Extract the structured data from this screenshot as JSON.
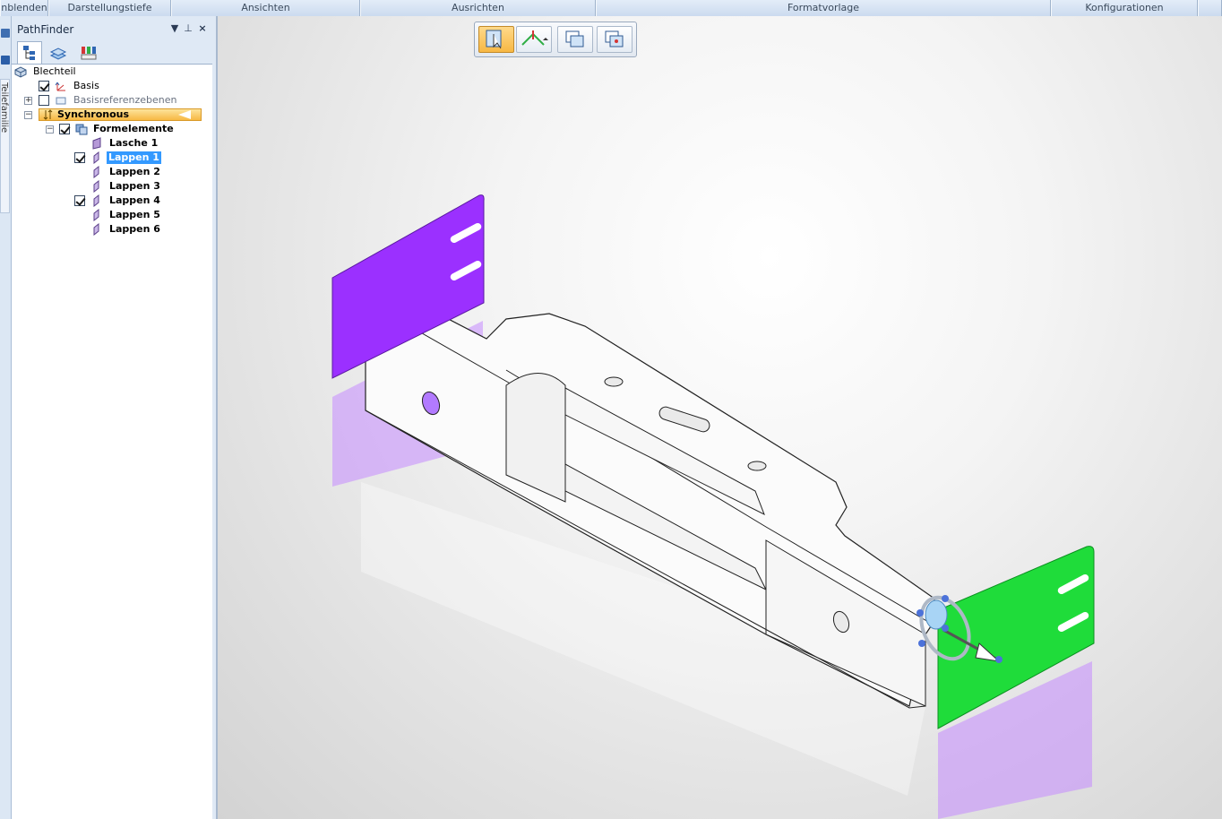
{
  "ribbon": {
    "groups": [
      "nblenden",
      "Darstellungstiefe",
      "Ansichten",
      "Ausrichten",
      "Formatvorlage",
      "Konfigurationen"
    ]
  },
  "side_tab": {
    "label": "Teilefamilie"
  },
  "pathfinder": {
    "title": "PathFinder",
    "tree": {
      "root": "Blechteil",
      "basis": "Basis",
      "basisreferenzebenen": "Basisreferenzebenen",
      "synchronous": "Synchronous",
      "formelemente": "Formelemente",
      "items": [
        "Lasche 1",
        "Lappen 1",
        "Lappen 2",
        "Lappen 3",
        "Lappen 4",
        "Lappen 5",
        "Lappen 6"
      ]
    }
  },
  "colors": {
    "selected_purple": "#9b30ff",
    "selected_green": "#1fdc3a",
    "highlight_orange": "#f7b843",
    "selection_blue": "#3399ff"
  },
  "icons": {
    "pathfinder_tabs": [
      "feature-tree-icon",
      "layers-icon",
      "appearance-icon"
    ],
    "view_toolbar": [
      "select-tool-icon",
      "steering-wheel-icon",
      "copy-face-icon",
      "move-face-icon"
    ]
  }
}
